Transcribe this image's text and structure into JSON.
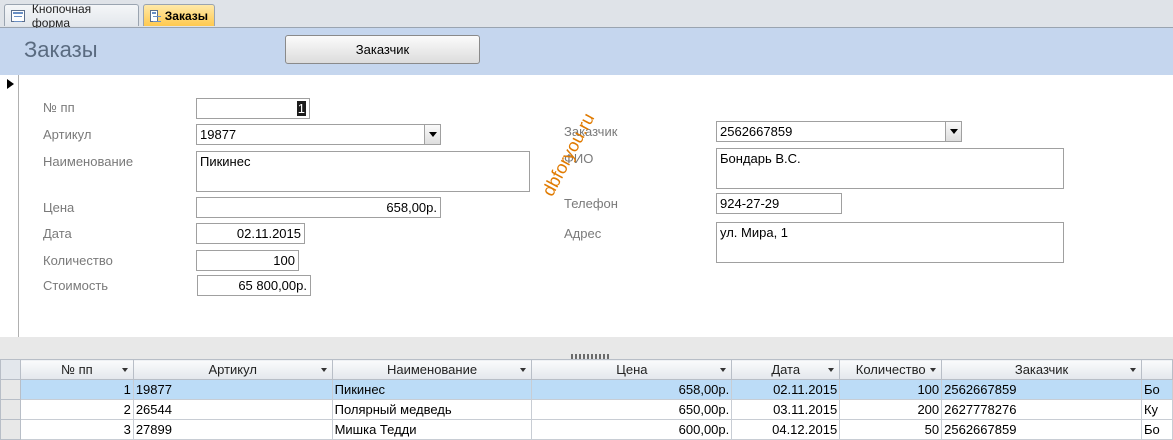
{
  "tabs": [
    {
      "label": "Кнопочная форма",
      "active": false
    },
    {
      "label": "Заказы",
      "active": true
    }
  ],
  "form": {
    "title": "Заказы",
    "customer_button": "Заказчик"
  },
  "fields": {
    "order_no": {
      "label": "№ пп",
      "value": "1"
    },
    "article": {
      "label": "Артикул",
      "value": "19877"
    },
    "name": {
      "label": "Наименование",
      "value": "Пикинес"
    },
    "price": {
      "label": "Цена",
      "value": "658,00р."
    },
    "date": {
      "label": "Дата",
      "value": "02.11.2015"
    },
    "quantity": {
      "label": "Количество",
      "value": "100"
    },
    "cost": {
      "label": "Стоимость",
      "value": "65 800,00р."
    },
    "customer": {
      "label": "Заказчик",
      "value": "2562667859"
    },
    "fio": {
      "label": "ФИО",
      "value": "Бондарь В.С."
    },
    "phone": {
      "label": "Телефон",
      "value": "924-27-29"
    },
    "address": {
      "label": "Адрес",
      "value": "ул. Мира, 1"
    }
  },
  "watermark": "dbforyou.ru",
  "grid": {
    "columns": [
      "№ пп",
      "Артикул",
      "Наименование",
      "Цена",
      "Дата",
      "Количество",
      "Заказчик"
    ],
    "rows": [
      {
        "no": "1",
        "article": "19877",
        "name": "Пикинес",
        "price": "658,00р.",
        "date": "02.11.2015",
        "qty": "100",
        "customer": "2562667859",
        "extra": "Бо"
      },
      {
        "no": "2",
        "article": "26544",
        "name": "Полярный медведь",
        "price": "650,00р.",
        "date": "03.11.2015",
        "qty": "200",
        "customer": "2627778276",
        "extra": "Ку"
      },
      {
        "no": "3",
        "article": "27899",
        "name": "Мишка Тедди",
        "price": "600,00р.",
        "date": "04.12.2015",
        "qty": "50",
        "customer": "2562667859",
        "extra": "Бо"
      }
    ]
  }
}
